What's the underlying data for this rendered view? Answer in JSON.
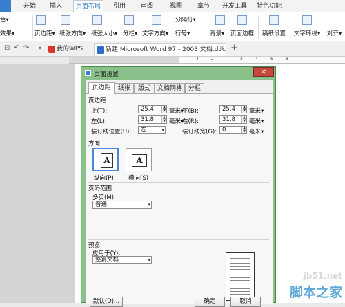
{
  "menubar": {
    "tabs": [
      "开始",
      "插入",
      "页面布局",
      "引用",
      "审阅",
      "视图",
      "章节",
      "开发工具",
      "特色功能"
    ],
    "active_tab": "页面布局"
  },
  "ribbon": {
    "items": [
      "色▾",
      "效果▾",
      "页边距▾",
      "纸张方向▾",
      "纸张大小▾",
      "分栏▾",
      "文字方向▾",
      "分隔符▾",
      "行号▾",
      "背景▾",
      "页面边框",
      "稿纸设置",
      "文字环绕▾",
      "对齐▾"
    ]
  },
  "tabbar": {
    "wps_tab": "我的WPS",
    "doc_tab": "新建 Microsoft Word 97 - 2003 文档.doc",
    "close_glyph": "✕",
    "add_glyph": "+"
  },
  "ruler": {
    "ticks": [
      "4",
      "2",
      "2",
      "4",
      "6",
      "8"
    ]
  },
  "dialog": {
    "title": "页面设置",
    "close_glyph": "✕",
    "tabs": [
      "页边距",
      "纸张",
      "版式",
      "文档网格",
      "分栏"
    ],
    "active_tab": "页边距",
    "margins": {
      "section": "页边距",
      "top_label": "上(T):",
      "top_value": "25.4",
      "bottom_label": "下(B):",
      "bottom_value": "25.4",
      "left_label": "左(L):",
      "left_value": "31.8",
      "right_label": "右(R):",
      "right_value": "31.8",
      "gutter_pos_label": "装订线位置(U):",
      "gutter_pos_value": "左",
      "gutter_width_label": "装订线宽(G):",
      "gutter_width_value": "0",
      "unit": "毫米▾"
    },
    "orientation": {
      "section": "方向",
      "portrait": "纵向(P)",
      "landscape": "横向(S)",
      "paper_letter": "A",
      "selected": "portrait"
    },
    "pages": {
      "section": "页码范围",
      "multiple_label": "多页(M):",
      "multiple_value": "普通"
    },
    "preview": {
      "section": "预览",
      "apply_label": "应用于(Y):",
      "apply_value": "整篇文档"
    },
    "buttons": {
      "default": "默认(D)...",
      "ok": "确定",
      "cancel": "取消"
    }
  },
  "watermark": {
    "url": "jb51.net",
    "name": "脚本之家"
  }
}
